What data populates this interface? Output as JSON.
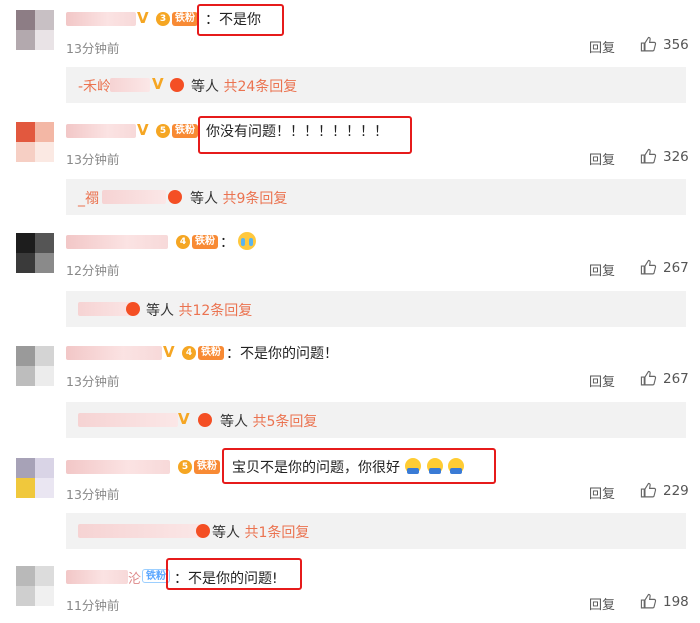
{
  "comments": [
    {
      "text": "：不是你",
      "time": "13分钟前",
      "reply_label": "回复",
      "likes": "356",
      "sub": {
        "prefix": "-禾岭",
        "others": "等人",
        "count": "共24条回复"
      }
    },
    {
      "text": "你没有问题！！！！！！！！",
      "time": "13分钟前",
      "reply_label": "回复",
      "likes": "326",
      "sub": {
        "prefix": "_禤",
        "others": "等人",
        "count": "共9条回复"
      }
    },
    {
      "text": "：",
      "time": "12分钟前",
      "reply_label": "回复",
      "likes": "267",
      "sub": {
        "others": "等人",
        "count": "共12条回复"
      }
    },
    {
      "text": "：不是你的问题！",
      "time": "13分钟前",
      "reply_label": "回复",
      "likes": "267",
      "sub": {
        "others": "等人",
        "count": "共5条回复"
      }
    },
    {
      "text": "宝贝不是你的问题，你很好",
      "time": "13分钟前",
      "reply_label": "回复",
      "likes": "229",
      "sub": {
        "others": "等人",
        "count": "共1条回复"
      }
    },
    {
      "text": "：不是你的问题!",
      "time": "11分钟前",
      "reply_label": "回复",
      "likes": "198"
    }
  ],
  "badges": {
    "fan_label": "铁粉",
    "crown_levels": [
      "3",
      "5",
      "4",
      "4",
      "5"
    ],
    "v_mark": "V",
    "name_suffix_6": "沦"
  },
  "colors": {
    "highlight": "#e61b1b",
    "reply_count": "#eb7350",
    "fan_badge": "#f88a34",
    "sub_background": "#f2f2f2"
  },
  "icons": [
    "thumb-up-icon",
    "crown-badge-icon",
    "verified-v-icon",
    "smiley-emoji-icon",
    "crying-emoji-icon"
  ]
}
